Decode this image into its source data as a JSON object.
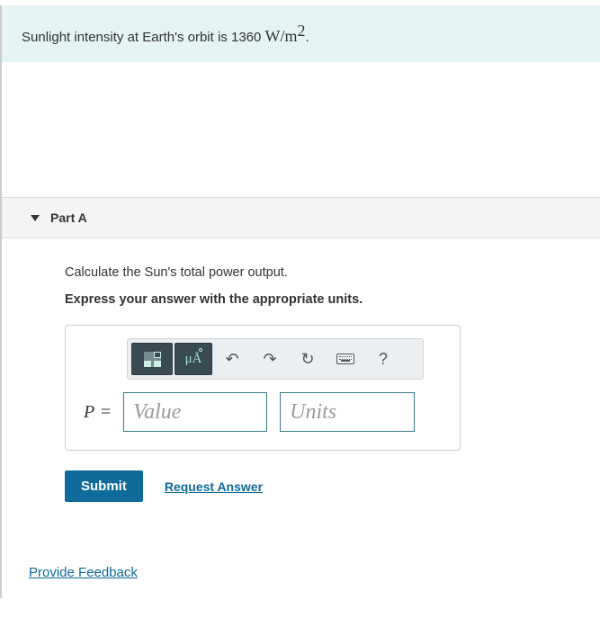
{
  "infobox": {
    "prefix": "Sunlight intensity at Earth's orbit is 1360 ",
    "unit_html": "W/m",
    "exponent": "2",
    "suffix": "."
  },
  "part": {
    "label": "Part A",
    "question": "Calculate the Sun's total power output.",
    "instruction": "Express your answer with the appropriate units."
  },
  "toolbar": {
    "templates": "templates",
    "symbols": "μÅ",
    "undo": "↶",
    "redo": "↷",
    "reset": "↻",
    "keyboard": "keyboard",
    "help": "?"
  },
  "answer": {
    "variable": "P",
    "equals": "=",
    "value_placeholder": "Value",
    "units_placeholder": "Units"
  },
  "actions": {
    "submit": "Submit",
    "request": "Request Answer"
  },
  "feedback": "Provide Feedback"
}
